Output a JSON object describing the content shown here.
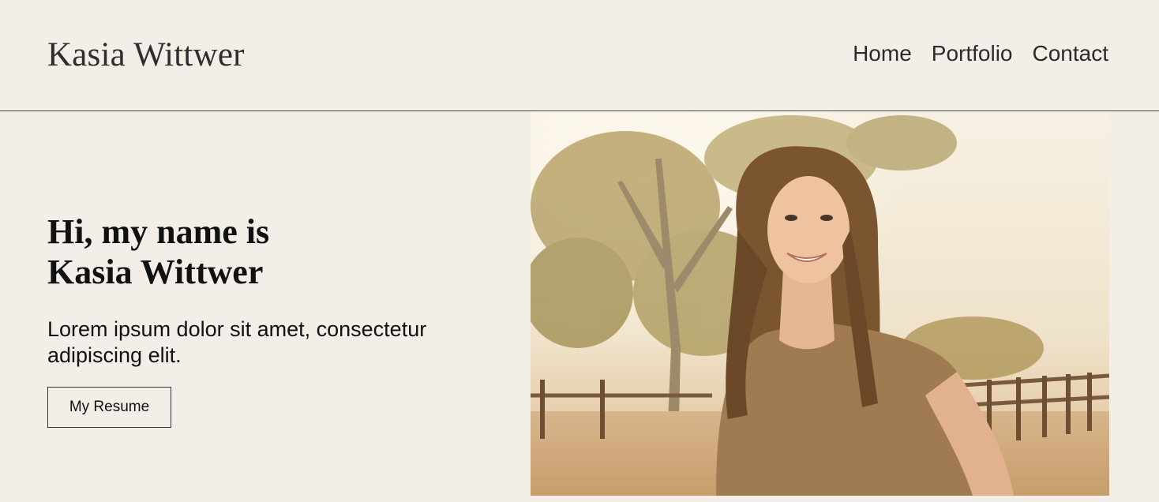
{
  "header": {
    "brand": "Kasia Wittwer",
    "nav": [
      "Home",
      "Portfolio",
      "Contact"
    ]
  },
  "hero": {
    "title_line1": "Hi, my name is",
    "title_line2": "Kasia Wittwer",
    "subtitle": "Lorem ipsum dolor sit amet, consectetur adipiscing elit.",
    "button_label": "My Resume"
  },
  "colors": {
    "background": "#f3efe8",
    "text": "#222222",
    "divider": "#444444",
    "shirt": "#a07b52",
    "hair": "#7a5530"
  }
}
